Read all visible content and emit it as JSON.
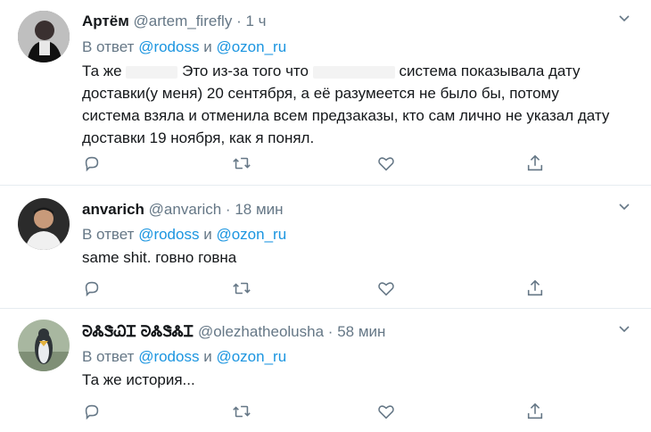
{
  "tweets": [
    {
      "name": "Артём",
      "handle": "@artem_firefly",
      "dot": "·",
      "time": "1 ч",
      "reply_prefix": "В ответ",
      "mention1": "@rodoss",
      "conj": "и",
      "mention2": "@ozon_ru",
      "text_a": "Та же ",
      "text_b": "Это из-за того что",
      "text_c": "система показывала дату доставки(у меня) 20 сентября, а её разумеется не было бы, потому система взяла и отменила всем предзаказы, кто сам лично не указал дату доставки 19 ноября, как я понял."
    },
    {
      "name": "anvarich",
      "handle": "@anvarich",
      "dot": "·",
      "time": "18 мин",
      "reply_prefix": "В ответ",
      "mention1": "@rodoss",
      "conj": "и",
      "mention2": "@ozon_ru",
      "text": "same shit. говно говна"
    },
    {
      "name": "ᘐᏜᏕᏇᏆ ᘐᏜᏕᏜᏆ",
      "handle": "@olezhatheolusha",
      "dot": "·",
      "time": "58 мин",
      "reply_prefix": "В ответ",
      "mention1": "@rodoss",
      "conj": "и",
      "mention2": "@ozon_ru",
      "text": "Та же история..."
    }
  ],
  "icons": [
    "reply-icon",
    "retweet-icon",
    "like-icon",
    "share-icon",
    "chevron-down-icon"
  ],
  "colors": {
    "accent": "#1b95e0",
    "muted": "#657786",
    "text": "#14171a",
    "border": "#e6ecf0"
  }
}
